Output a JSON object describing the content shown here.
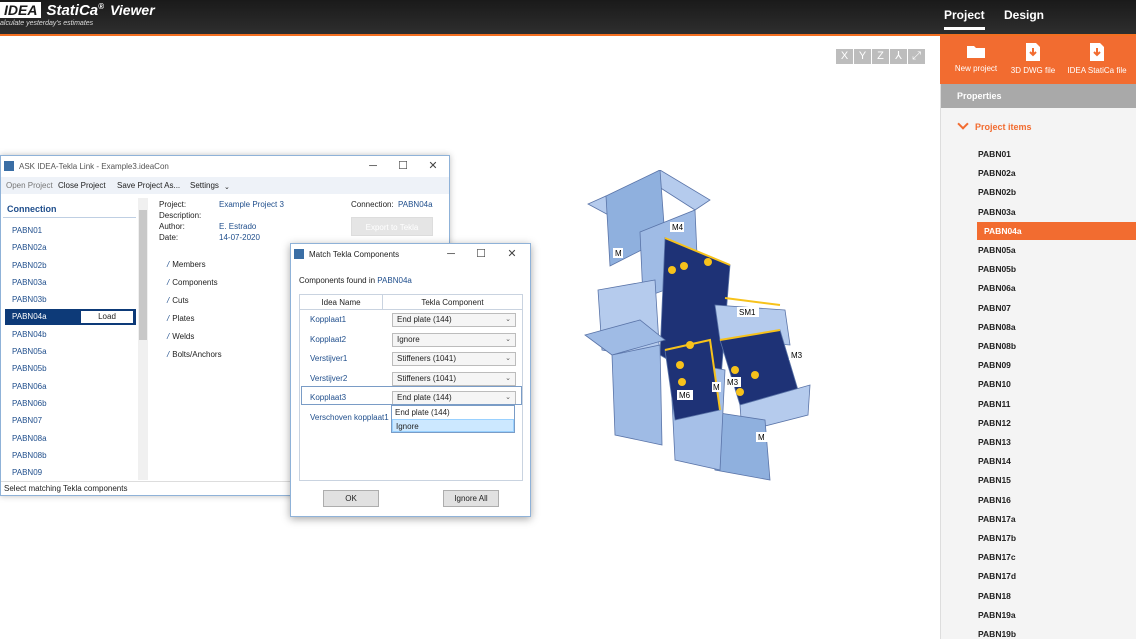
{
  "header": {
    "logo_box": "IDEA",
    "logo_main": "StatiCa",
    "logo_reg": "®",
    "logo_suffix": "Viewer",
    "tagline": "alculate yesterday's estimates",
    "nav": [
      {
        "label": "Project",
        "active": true
      },
      {
        "label": "Design",
        "active": false
      }
    ]
  },
  "ribbon": {
    "buttons": [
      {
        "label": "New project",
        "icon": "folder-icon"
      },
      {
        "label": "3D DWG file",
        "icon": "download-file-icon"
      },
      {
        "label": "IDEA StatiCa file",
        "icon": "download-file-icon"
      }
    ]
  },
  "view_buttons": [
    "X",
    "Y",
    "Z",
    "⅄",
    "⤢"
  ],
  "properties": {
    "title": "Properties",
    "group": "Project items",
    "items": [
      "PABN01",
      "PABN02a",
      "PABN02b",
      "PABN03a",
      "PABN04a",
      "PABN05a",
      "PABN05b",
      "PABN06a",
      "PABN07",
      "PABN08a",
      "PABN08b",
      "PABN09",
      "PABN10",
      "PABN11",
      "PABN12",
      "PABN13",
      "PABN14",
      "PABN15",
      "PABN16",
      "PABN17a",
      "PABN17b",
      "PABN17c",
      "PABN17d",
      "PABN18",
      "PABN19a",
      "PABN19b"
    ],
    "selected": "PABN04a"
  },
  "tekla_window": {
    "title": "ASK IDEA-Tekla Link - Example3.ideaCon",
    "menu": [
      "Open Project",
      "Close Project",
      "Save Project As...",
      "Settings"
    ],
    "list_header": "Connection",
    "connections": [
      "PABN01",
      "PABN02a",
      "PABN02b",
      "PABN03a",
      "PABN03b",
      "PABN04a",
      "PABN04b",
      "PABN05a",
      "PABN05b",
      "PABN06a",
      "PABN06b",
      "PABN07",
      "PABN08a",
      "PABN08b",
      "PABN09"
    ],
    "selected": "PABN04a",
    "load_label": "Load",
    "info_labels": {
      "project": "Project:",
      "description": "Description:",
      "author": "Author:",
      "date": "Date:",
      "connection": "Connection:"
    },
    "info_values": {
      "project": "Example Project 3",
      "author": "E. Estrado",
      "date": "14-07-2020",
      "connection": "PABN04a"
    },
    "export_label": "Export to Tekla",
    "tree": [
      "Members",
      "Components",
      "Cuts",
      "Plates",
      "Welds",
      "Bolts/Anchors"
    ],
    "status": "Select matching Tekla components"
  },
  "match_dialog": {
    "title": "Match Tekla Components",
    "found_prefix": "Components found in",
    "found_value": "PABN04a",
    "col_idea": "Idea Name",
    "col_tekla": "Tekla Component",
    "rows": [
      {
        "name": "Kopplaat1",
        "value": "End plate (144)"
      },
      {
        "name": "Kopplaat2",
        "value": "Ignore"
      },
      {
        "name": "Verstijver1",
        "value": "Stiffeners (1041)"
      },
      {
        "name": "Verstijver2",
        "value": "Stiffeners (1041)"
      },
      {
        "name": "Kopplaat3",
        "value": "End plate (144)"
      },
      {
        "name": "Verschoven kopplaat1",
        "value": ""
      }
    ],
    "dropdown_options": [
      "End plate (144)",
      "Ignore"
    ],
    "ok_label": "OK",
    "ignore_all_label": "Ignore All"
  },
  "model_labels": [
    "M4",
    "M",
    "SM1",
    "M3",
    "M3",
    "M6",
    "M",
    "M"
  ],
  "colors": {
    "accent": "#f26c30",
    "steel": "#8fb0de",
    "plate": "#1e3276",
    "weld": "#f7c21b"
  }
}
